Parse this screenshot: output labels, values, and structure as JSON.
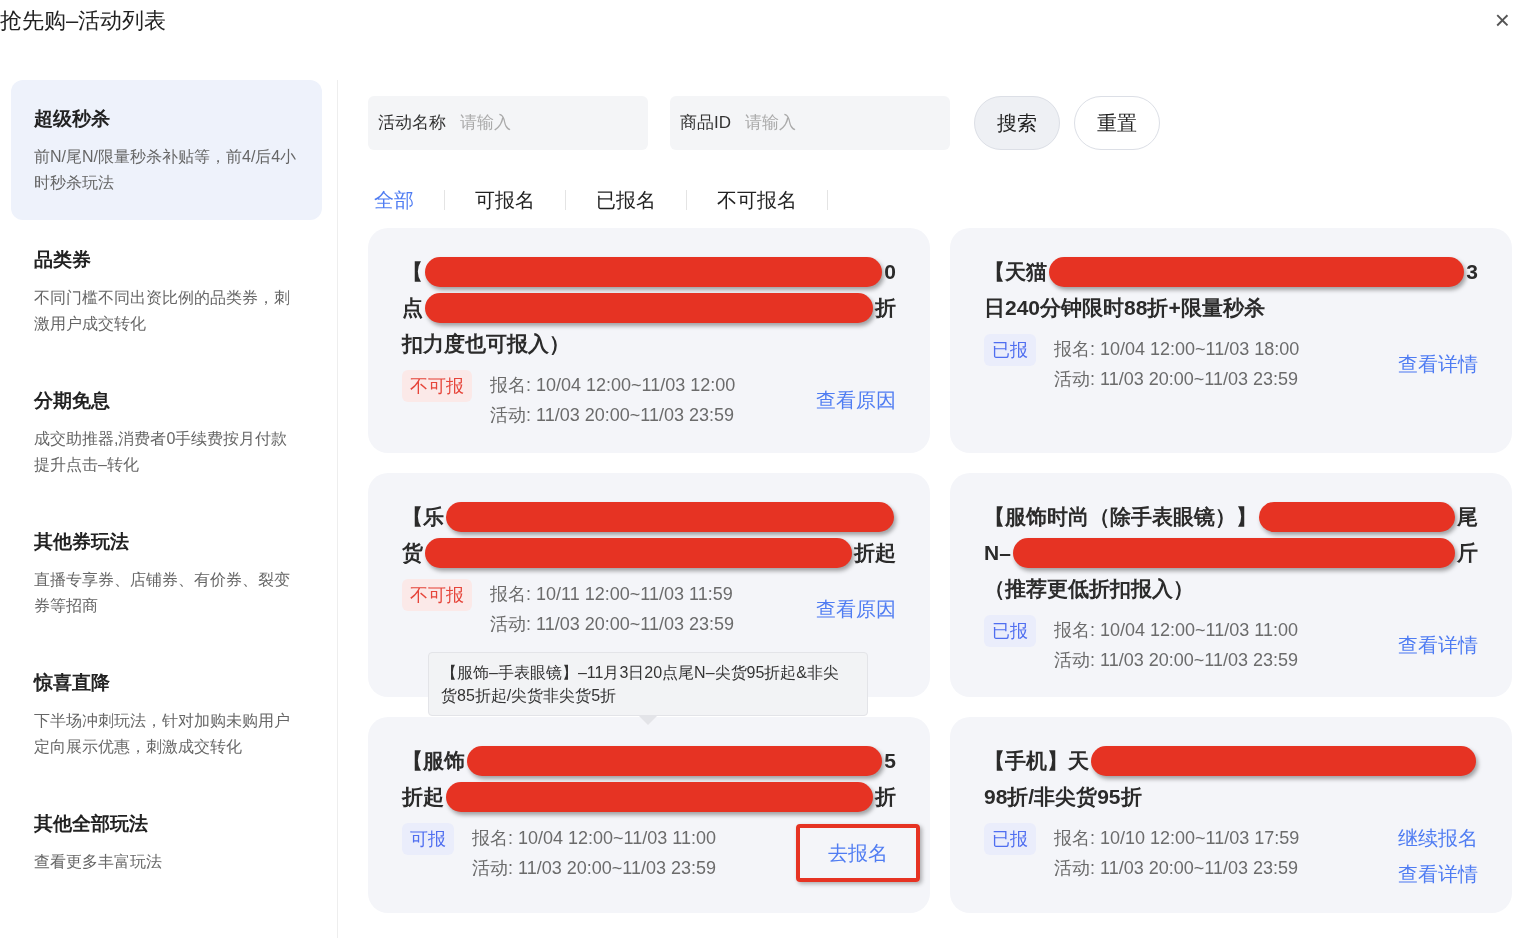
{
  "window": {
    "title": "抢先购–活动列表",
    "close": "×"
  },
  "sidebar": {
    "items": [
      {
        "title": "超级秒杀",
        "desc": "前N/尾N/限量秒杀补贴等，前4/后4小时秒杀玩法",
        "selected": true
      },
      {
        "title": "品类券",
        "desc": "不同门槛不同出资比例的品类券，刺激用户成交转化",
        "selected": false
      },
      {
        "title": "分期免息",
        "desc": "成交助推器,消费者0手续费按月付款提升点击–转化",
        "selected": false
      },
      {
        "title": "其他券玩法",
        "desc": "直播专享券、店铺券、有价券、裂变券等招商",
        "selected": false
      },
      {
        "title": "惊喜直降",
        "desc": "下半场冲刺玩法，针对加购未购用户定向展示优惠，刺激成交转化",
        "selected": false
      },
      {
        "title": "其他全部玩法",
        "desc": "查看更多丰富玩法",
        "selected": false
      }
    ]
  },
  "search": {
    "fields": [
      {
        "label": "活动名称",
        "placeholder": "请输入"
      },
      {
        "label": "商品ID",
        "placeholder": "请输入"
      }
    ],
    "buttons": [
      {
        "label": "搜索",
        "kind": "primary"
      },
      {
        "label": "重置",
        "kind": "secondary"
      }
    ]
  },
  "tabs": [
    {
      "label": "全部",
      "selected": true
    },
    {
      "label": "可报名",
      "selected": false
    },
    {
      "label": "已报名",
      "selected": false
    },
    {
      "label": "不可报名",
      "selected": false
    }
  ],
  "cards": [
    {
      "title_lines": [
        [
          {
            "kind": "text",
            "text": "【"
          },
          {
            "kind": "redaction"
          },
          {
            "kind": "text",
            "text": "0"
          }
        ],
        [
          {
            "kind": "text",
            "text": "点"
          },
          {
            "kind": "redaction"
          },
          {
            "kind": "text",
            "text": "折"
          }
        ],
        [
          {
            "kind": "text",
            "text": "扣力度也可报入）"
          }
        ]
      ],
      "status": {
        "kind": "unavailable",
        "label": "不可报"
      },
      "signup": "报名: 10/04 12:00~11/03 12:00",
      "activity": "活动: 11/03 20:00~11/03 23:59",
      "actions": [
        {
          "label": "查看原因",
          "highlighted": false
        }
      ]
    },
    {
      "title_lines": [
        [
          {
            "kind": "text",
            "text": "【天猫"
          },
          {
            "kind": "redaction"
          },
          {
            "kind": "text",
            "text": "3"
          }
        ],
        [
          {
            "kind": "text",
            "text": "日240分钟限时88折+限量秒杀"
          }
        ]
      ],
      "status": {
        "kind": "registered",
        "label": "已报"
      },
      "signup": "报名: 10/04 12:00~11/03 18:00",
      "activity": "活动: 11/03 20:00~11/03 23:59",
      "actions": [
        {
          "label": "查看详情",
          "highlighted": false
        }
      ]
    },
    {
      "title_lines": [
        [
          {
            "kind": "text",
            "text": "【乐"
          },
          {
            "kind": "redaction"
          }
        ],
        [
          {
            "kind": "text",
            "text": "货"
          },
          {
            "kind": "redaction"
          },
          {
            "kind": "text",
            "text": "折起"
          }
        ]
      ],
      "status": {
        "kind": "unavailable",
        "label": "不可报"
      },
      "signup": "报名: 10/11 12:00~11/03 11:59",
      "activity": "活动: 11/03 20:00~11/03 23:59",
      "actions": [
        {
          "label": "查看原因",
          "highlighted": false
        }
      ]
    },
    {
      "title_lines": [
        [
          {
            "kind": "text",
            "text": "【服饰时尚（除手表眼镜）】"
          },
          {
            "kind": "redaction"
          },
          {
            "kind": "text",
            "text": "尾"
          }
        ],
        [
          {
            "kind": "text",
            "text": "N–"
          },
          {
            "kind": "redaction"
          },
          {
            "kind": "text",
            "text": "斤"
          }
        ],
        [
          {
            "kind": "text",
            "text": "（推荐更低折扣报入）"
          }
        ]
      ],
      "status": {
        "kind": "registered",
        "label": "已报"
      },
      "signup": "报名: 10/04 12:00~11/03 11:00",
      "activity": "活动: 11/03 20:00~11/03 23:59",
      "actions": [
        {
          "label": "查看详情",
          "highlighted": false
        }
      ]
    },
    {
      "tooltip": "【服饰–手表眼镜】–11月3日20点尾N–尖货95折起&非尖货85折起/尖货非尖货5折",
      "title_lines": [
        [
          {
            "kind": "text",
            "text": "【服饰"
          },
          {
            "kind": "redaction"
          },
          {
            "kind": "text",
            "text": "5"
          }
        ],
        [
          {
            "kind": "text",
            "text": "折起"
          },
          {
            "kind": "redaction"
          },
          {
            "kind": "text",
            "text": "折"
          }
        ]
      ],
      "status": {
        "kind": "available",
        "label": "可报"
      },
      "signup": "报名: 10/04 12:00~11/03 11:00",
      "activity": "活动: 11/03 20:00~11/03 23:59",
      "actions": [
        {
          "label": "去报名",
          "highlighted": true
        }
      ]
    },
    {
      "title_lines": [
        [
          {
            "kind": "text",
            "text": "【手机】天"
          },
          {
            "kind": "redaction"
          }
        ],
        [
          {
            "kind": "text",
            "text": "98折/非尖货95折"
          }
        ]
      ],
      "status": {
        "kind": "registered",
        "label": "已报"
      },
      "signup": "报名: 10/10 12:00~11/03 17:59",
      "activity": "活动: 11/03 20:00~11/03 23:59",
      "actions": [
        {
          "label": "继续报名",
          "highlighted": false
        },
        {
          "label": "查看详情",
          "highlighted": false
        }
      ]
    }
  ]
}
